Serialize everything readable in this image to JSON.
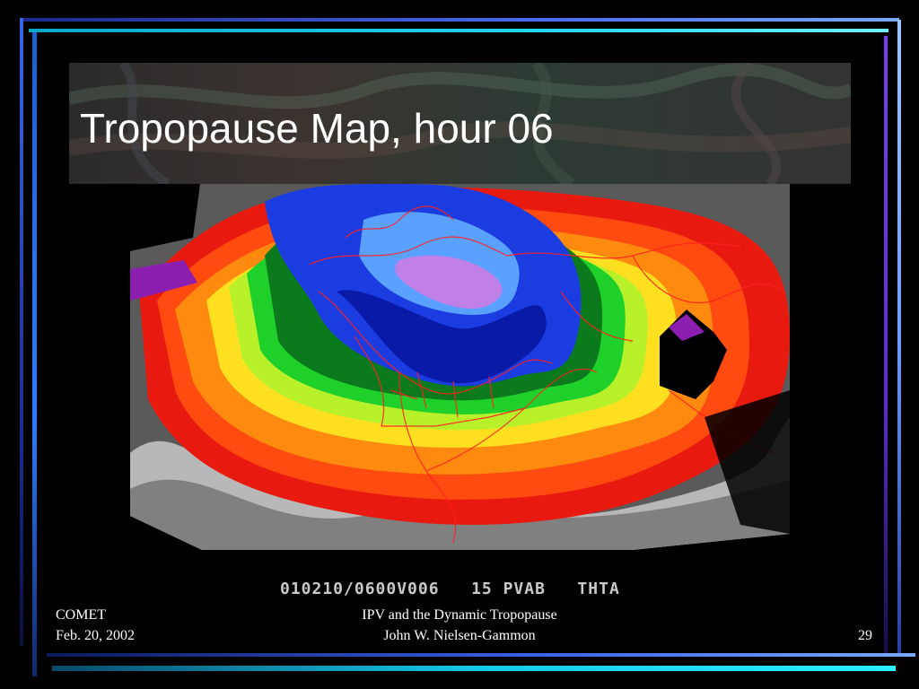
{
  "slide": {
    "title": "Tropopause Map, hour 06",
    "map_caption": "010210/0600V006   15 PVAB   THTA",
    "number": "29"
  },
  "footer": {
    "left_line1": "COMET",
    "left_line2": "Feb. 20, 2002",
    "center_line1": "IPV and the Dynamic Tropopause",
    "center_line2": "John W. Nielsen-Gammon"
  },
  "map": {
    "colors": {
      "purple": "#8c1fb0",
      "magenta": "#c080e8",
      "light_blue": "#5aa0ff",
      "blue": "#1a3ce0",
      "dark_blue": "#0a1aa8",
      "green_dark": "#0b7a1c",
      "green": "#1fcf2a",
      "yellow_green": "#b8f02a",
      "yellow": "#ffe020",
      "orange": "#ff8a10",
      "red_orange": "#ff4a10",
      "red": "#e81a10",
      "gray_light": "#b8b8b8",
      "gray": "#808080",
      "gray_dark": "#4a4a4a",
      "outline": "#ff2020"
    }
  }
}
